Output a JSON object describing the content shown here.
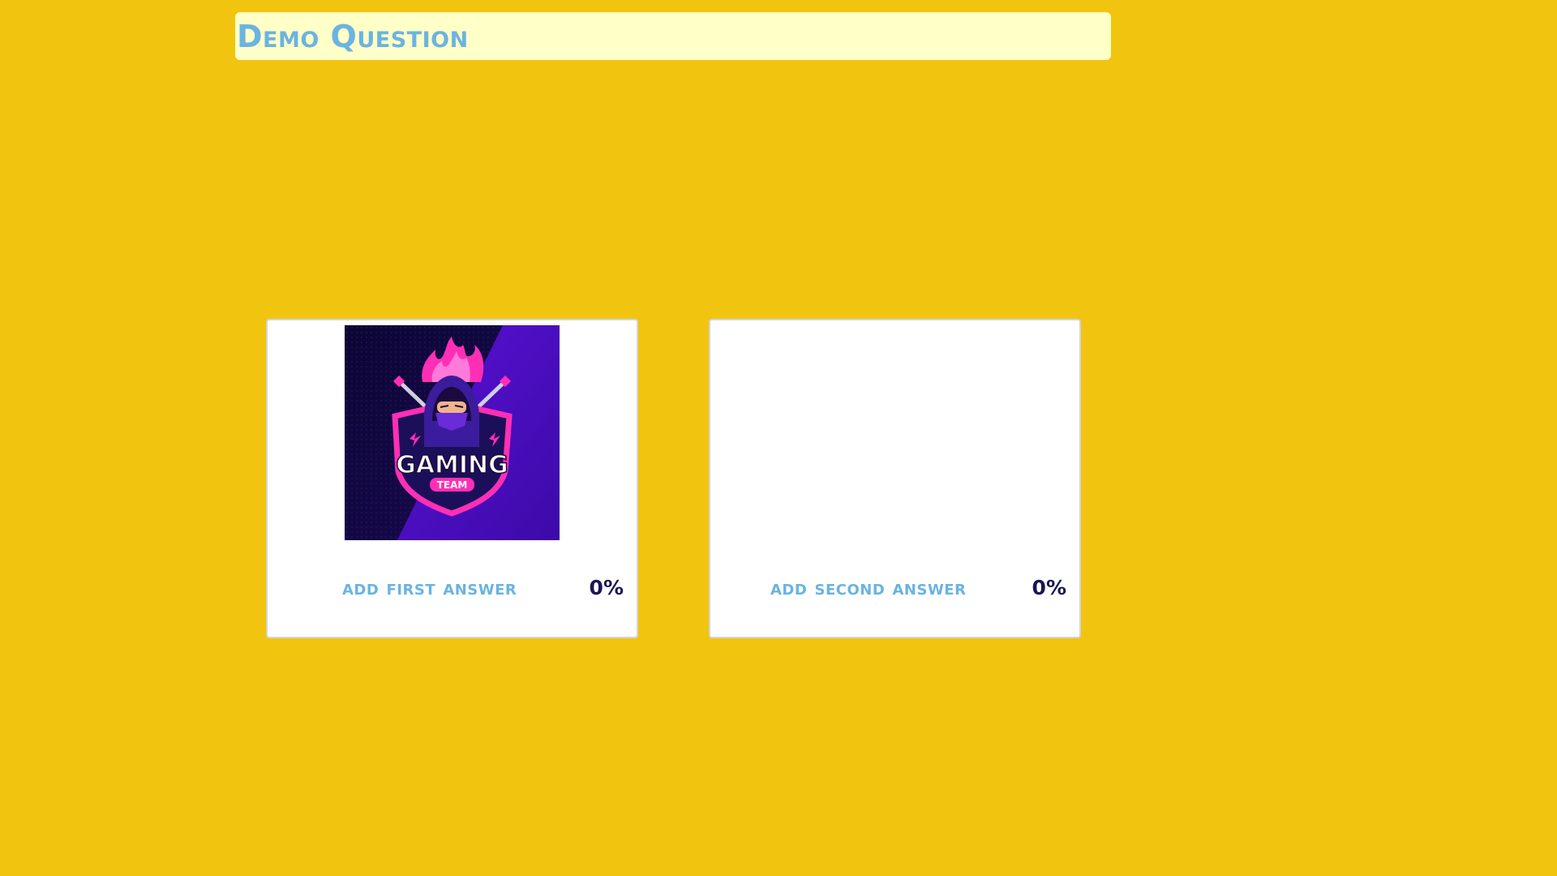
{
  "question": {
    "title": "Demo Question"
  },
  "answers": [
    {
      "label": "add first answer",
      "percent": "0%",
      "image": {
        "icon": "gaming-team-ninja-logo",
        "logo_text": "GAMING",
        "logo_subtext": "TEAM"
      }
    },
    {
      "label": "add second answer",
      "percent": "0%"
    }
  ],
  "colors": {
    "background": "#f1c40f",
    "question_bar": "#ffffc8",
    "accent_text": "#6ab4e0",
    "percent_text": "#1a1654",
    "logo_pink": "#ff2fb5",
    "logo_purple": "#4b0fc7"
  }
}
